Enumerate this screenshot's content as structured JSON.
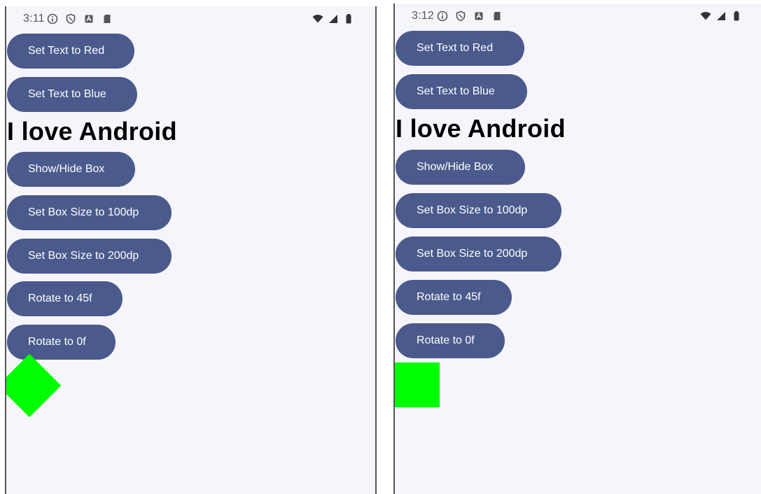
{
  "left_screen": {
    "status": {
      "time": "3:11",
      "icons": [
        "info-icon",
        "shield-icon",
        "a-icon",
        "sd-card-icon",
        "wifi-icon",
        "signal-icon",
        "battery-icon"
      ]
    },
    "buttons": {
      "red": "Set Text to Red",
      "blue": "Set Text to Blue",
      "toggle": "Show/Hide Box",
      "size100": "Set Box Size to 100dp",
      "size200": "Set Box Size to 200dp",
      "rotate45": "Rotate to 45f",
      "rotate0": "Rotate to 0f"
    },
    "headline": "I love Android",
    "box": {
      "color": "#00ff00",
      "rotation_deg": 45
    }
  },
  "right_screen": {
    "status": {
      "time": "3:12",
      "icons": [
        "info-icon",
        "shield-icon",
        "a-icon",
        "sd-card-icon",
        "wifi-icon",
        "signal-icon",
        "battery-icon"
      ]
    },
    "buttons": {
      "red": "Set Text to Red",
      "blue": "Set Text to Blue",
      "toggle": "Show/Hide Box",
      "size100": "Set Box Size to 100dp",
      "size200": "Set Box Size to 200dp",
      "rotate45": "Rotate to 45f",
      "rotate0": "Rotate to 0f"
    },
    "headline": "I love Android",
    "box": {
      "color": "#00ff00",
      "rotation_deg": 0
    }
  },
  "theme": {
    "button_color": "#4a5a8c",
    "background": "#f7f5fc",
    "text_color": "#000000"
  }
}
